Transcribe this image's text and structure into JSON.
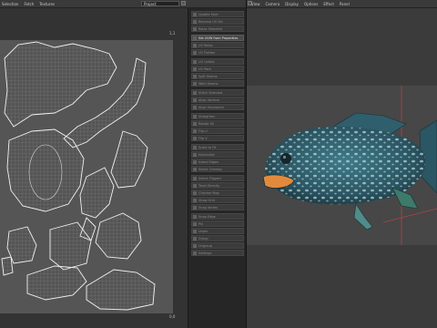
{
  "menubar": {
    "left_items": [
      "Selection",
      "Fetch",
      "Textures"
    ],
    "project_select": "Project",
    "right_items": [
      "View",
      "Camera",
      "Display",
      "Options",
      "Effect",
      "Panel"
    ]
  },
  "uv_editor": {
    "corner_label": "1,1",
    "origin_label": "0,0"
  },
  "tool_panel": {
    "active_item": "Set UVW from Properties",
    "items": [
      "Update Face",
      "Reverse UV Sel",
      "Relax Selected",
      "Set UVW from Properties",
      "UV Relax",
      "UV Flatten",
      "UV Unfold",
      "UV Pack",
      "Split Seams",
      "Weld Seams",
      "Stitch Selected",
      "Align Vertical",
      "Align Horizontal",
      "Straighten",
      "Rotate 90",
      "Flip U",
      "Flip V",
      "Scale to Fit",
      "Normalize",
      "Island Edges",
      "Select Overlap",
      "Select Flipped",
      "Texel Density",
      "Checker Map",
      "Show Grid",
      "Snap Vertex",
      "Snap Edge",
      "Pin",
      "Unpin",
      "Group",
      "Ungroup",
      "Settings"
    ]
  },
  "colors": {
    "fish_body": "#2e5f6c",
    "fish_spots": "#c9dfe2",
    "fish_mouth": "#e28a3c",
    "accent_red": "#e04040"
  }
}
